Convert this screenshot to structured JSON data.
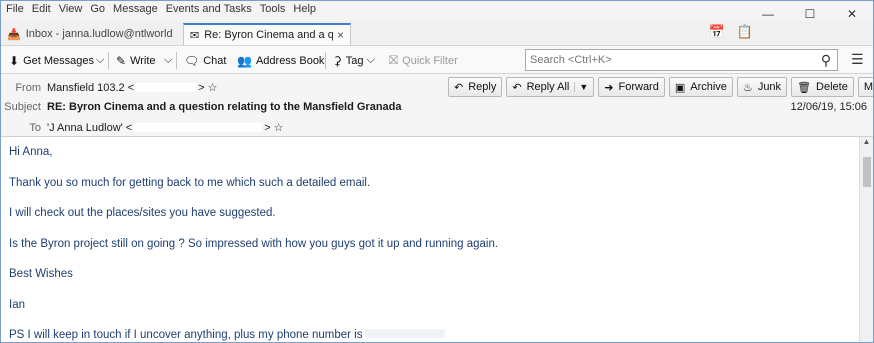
{
  "menu": [
    "File",
    "Edit",
    "View",
    "Go",
    "Message",
    "Events and Tasks",
    "Tools",
    "Help"
  ],
  "window_controls": [
    "minimize-icon",
    "maximize-icon",
    "close-icon"
  ],
  "tabs": [
    {
      "label": "Inbox - janna.ludlow@ntlworld",
      "icon": "inbox-icon"
    },
    {
      "label": "Re: Byron Cinema and a que",
      "icon": "envelope-icon",
      "close": "×"
    }
  ],
  "toolbar": {
    "get_messages": "Get Messages",
    "write": "Write",
    "chat": "Chat",
    "address_book": "Address Book",
    "tag": "Tag",
    "quick_filter": "Quick Filter",
    "search_placeholder": "Search <Ctrl+K>"
  },
  "message": {
    "from_label": "From",
    "from_value": "Mansfield 103.2 <",
    "subject_label": "Subject",
    "subject_value": "RE: Byron Cinema and a question relating to the Mansfield Granada",
    "to_label": "To",
    "to_value": "'J Anna Ludlow' <",
    "date": "12/06/19, 15:06",
    "actions": {
      "reply": "Reply",
      "reply_all": "Reply All",
      "forward": "Forward",
      "archive": "Archive",
      "junk": "Junk",
      "delete": "Delete",
      "more": "More"
    }
  },
  "body_lines": [
    "Hi Anna,",
    "Thank you so much for getting back to me which such a detailed email.",
    "I will check out the places/sites you have suggested.",
    "Is the Byron project still on going ? So impressed with how you guys got it up and running again.",
    "Best Wishes",
    "Ian",
    "PS I will keep in touch if I uncover anything, plus my phone number is"
  ],
  "colors": {
    "body_text": "#1f3f70",
    "active_tab_accent": "#3c7fd1"
  }
}
